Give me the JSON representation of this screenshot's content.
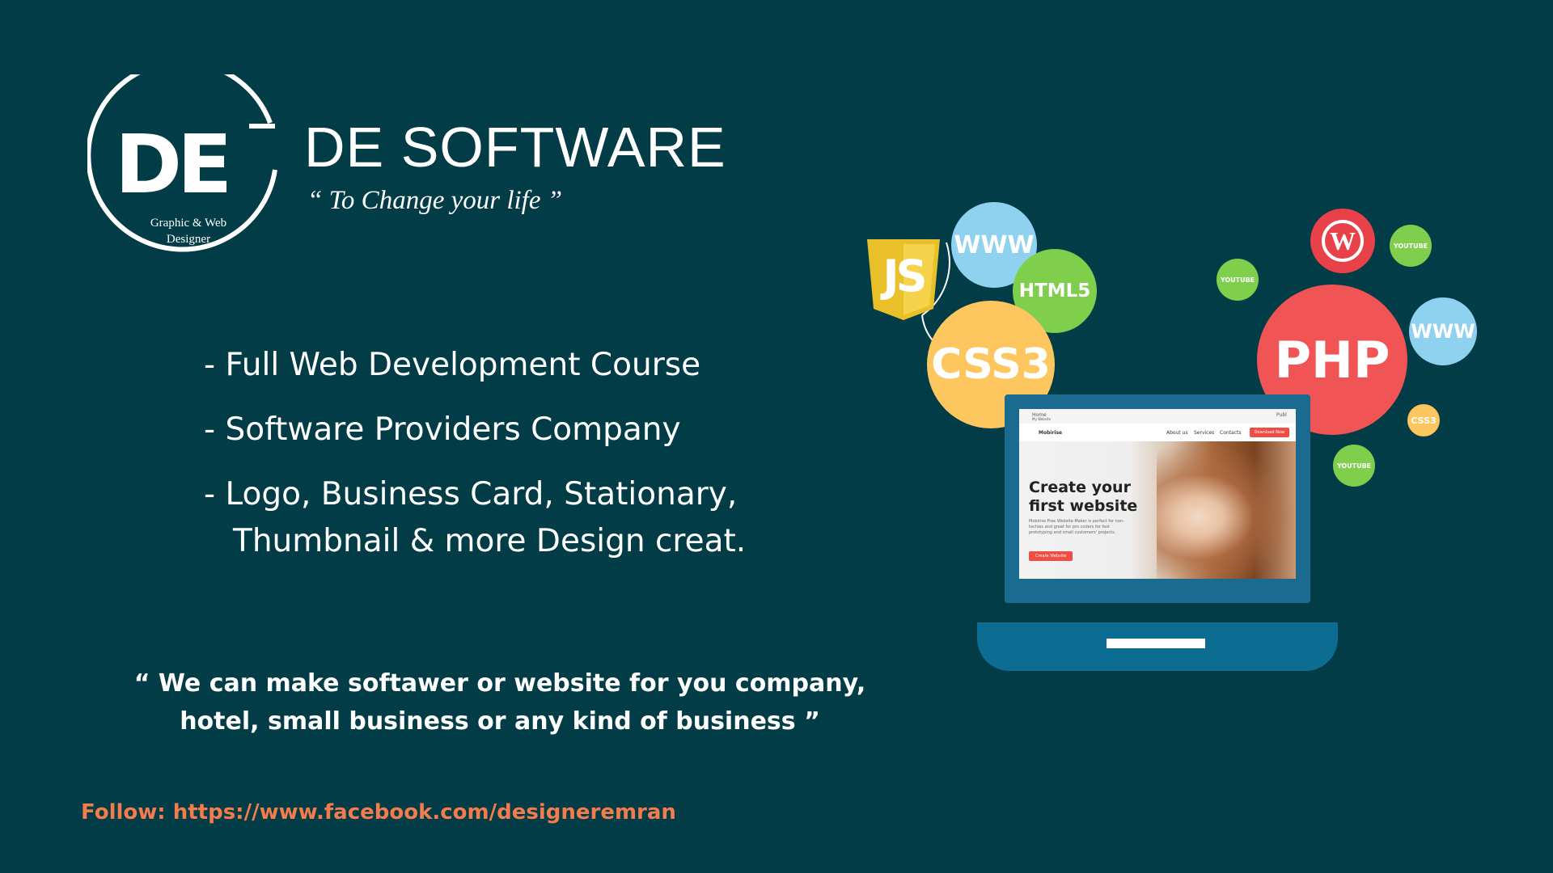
{
  "brand": {
    "logo_letters": "DE",
    "logo_subtitle": [
      "Graphic & Web",
      "Designer"
    ],
    "name": "DE SOFTWARE",
    "tagline": "“ To Change your life ”"
  },
  "services": [
    "- Full Web Development Course",
    "- Software Providers Company",
    "- Logo, Business Card, Stationary,",
    "Thumbnail & more Design creat."
  ],
  "quote": {
    "line1": "“ We can make softawer or website for you company,",
    "line2": "hotel, small business or any kind of business ”"
  },
  "follow": "Follow: https://www.facebook.com/designeremran",
  "illustration": {
    "bubbles": {
      "www_1": "WWW",
      "html5": "HTML5",
      "css3_large": "CSS3",
      "php": "PHP",
      "www_2": "WWW",
      "youtube_1": "YOUTUBE",
      "youtube_2": "YOUTUBE",
      "youtube_3": "YOUTUBE",
      "css3_small": "CSS3"
    },
    "js_badge": "JS",
    "screen": {
      "toolbar_home": "Home",
      "toolbar_site": "My Website",
      "toolbar_publish": "Publ",
      "brand": "Mobirise",
      "nav": [
        "About us",
        "Services",
        "Contacts"
      ],
      "download": "Download Now",
      "hero_title": "Create your first website",
      "hero_text": "Mobirise Free Website Maker is perfect for non-techies and great for pro coders for fast prototyping and small customers' projects.",
      "hero_button": "Create Website"
    }
  },
  "colors": {
    "background": "#023c46",
    "follow_text": "#f47c4c",
    "php": "#f05454",
    "css3": "#fdc65f",
    "html5": "#7fcf4d",
    "www": "#8fd2f0",
    "wordpress": "#e8414a",
    "youtube": "#7fcf4d",
    "laptop": "#0c6c91"
  }
}
